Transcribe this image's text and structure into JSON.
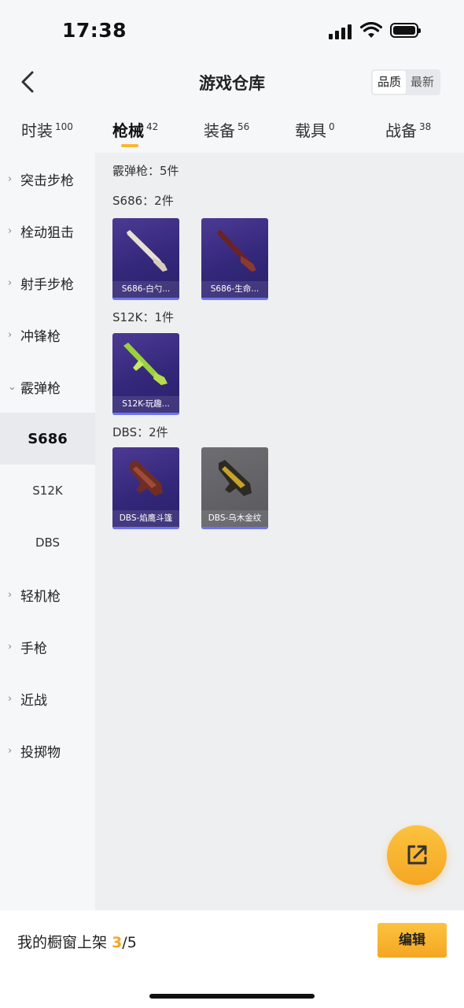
{
  "status": {
    "time": "17:38"
  },
  "nav": {
    "title": "游戏仓库",
    "sort_quality": "品质",
    "sort_newest": "最新"
  },
  "tabs": [
    {
      "label": "时装",
      "count": "100"
    },
    {
      "label": "枪械",
      "count": "42"
    },
    {
      "label": "装备",
      "count": "56"
    },
    {
      "label": "载具",
      "count": "0"
    },
    {
      "label": "战备",
      "count": "38"
    }
  ],
  "sidebar": {
    "items": [
      {
        "label": "突击步枪",
        "chevron": "›"
      },
      {
        "label": "栓动狙击",
        "chevron": "›"
      },
      {
        "label": "射手步枪",
        "chevron": "›"
      },
      {
        "label": "冲锋枪",
        "chevron": "›"
      },
      {
        "label": "霰弹枪",
        "chevron": "⌄"
      },
      {
        "label": "S686"
      },
      {
        "label": "S12K"
      },
      {
        "label": "DBS"
      },
      {
        "label": "轻机枪",
        "chevron": "›"
      },
      {
        "label": "手枪",
        "chevron": "›"
      },
      {
        "label": "近战",
        "chevron": "›"
      },
      {
        "label": "投掷物",
        "chevron": "›"
      }
    ]
  },
  "main": {
    "category_summary": "霰弹枪：5件",
    "groups": [
      {
        "title": "S686：2件",
        "items": [
          {
            "name": "S686-白勺...",
            "style": "purple",
            "gun_color": "#e8e0d4"
          },
          {
            "name": "S686-生命...",
            "style": "purple",
            "gun_color": "#7a2a2a"
          }
        ]
      },
      {
        "title": "S12K：1件",
        "items": [
          {
            "name": "S12K-玩趣...",
            "style": "purple",
            "gun_color": "#9bd23c"
          }
        ]
      },
      {
        "title": "DBS：2件",
        "items": [
          {
            "name": "DBS-焰鹰斗篷",
            "style": "purple",
            "gun_color": "#8a3b2a"
          },
          {
            "name": "DBS-乌木金纹",
            "style": "grey",
            "gun_color": "#c9a227"
          }
        ]
      }
    ]
  },
  "footer": {
    "shelf_label": "我的橱窗上架",
    "shelf_current": "3",
    "shelf_total": "/5",
    "edit_label": "编辑"
  },
  "colors": {
    "accent": "#f5a623",
    "card_purple": "#33277a",
    "card_bar": "#6e74f0"
  }
}
